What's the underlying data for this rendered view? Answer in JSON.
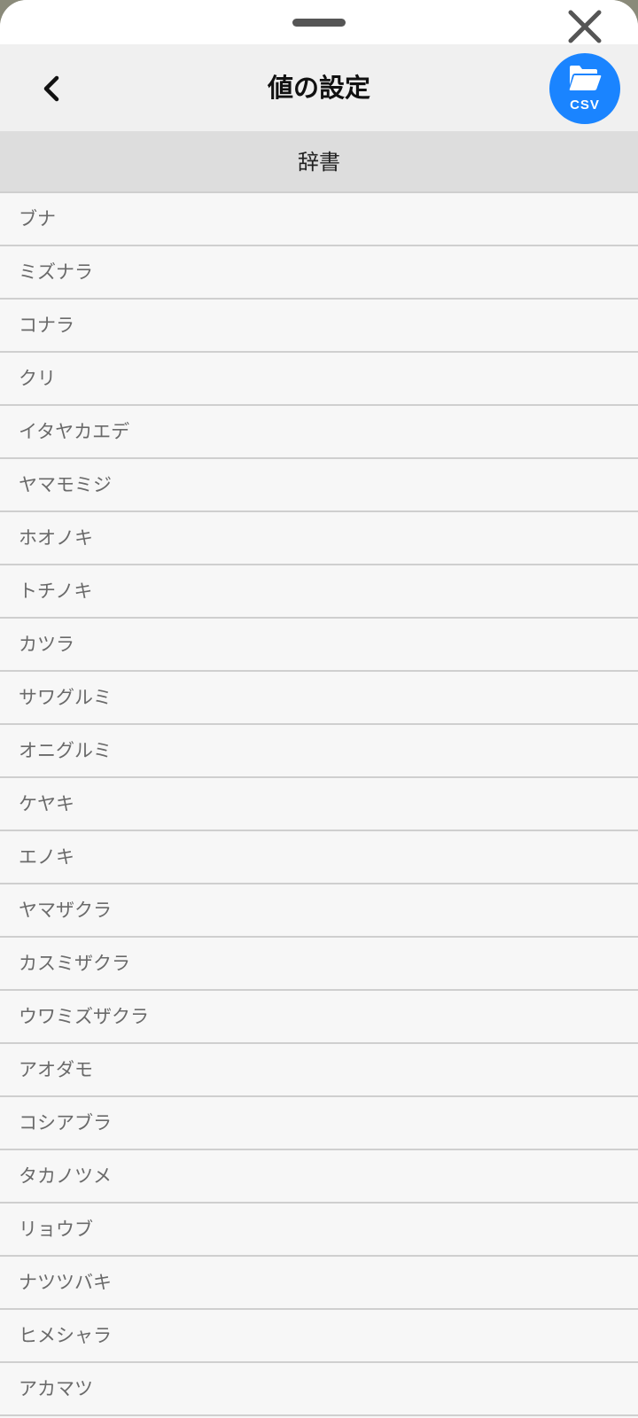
{
  "header": {
    "title": "値の設定",
    "csv_button_label": "CSV",
    "icons": {
      "back": "chevron-left-icon",
      "close": "close-icon",
      "csv": "folder-open-icon"
    }
  },
  "section": {
    "title": "辞書"
  },
  "items": [
    "ブナ",
    "ミズナラ",
    "コナラ",
    "クリ",
    "イタヤカエデ",
    "ヤマモミジ",
    "ホオノキ",
    "トチノキ",
    "カツラ",
    "サワグルミ",
    "オニグルミ",
    "ケヤキ",
    "エノキ",
    "ヤマザクラ",
    "カスミザクラ",
    "ウワミズザクラ",
    "アオダモ",
    "コシアブラ",
    "タカノツメ",
    "リョウブ",
    "ナツツバキ",
    "ヒメシャラ",
    "アカマツ"
  ],
  "colors": {
    "accent": "#1a84ff",
    "header_bg": "#f0f0f0",
    "section_bg": "#dddddd",
    "list_bg": "#f7f7f7",
    "item_text": "#6a6a6a"
  }
}
